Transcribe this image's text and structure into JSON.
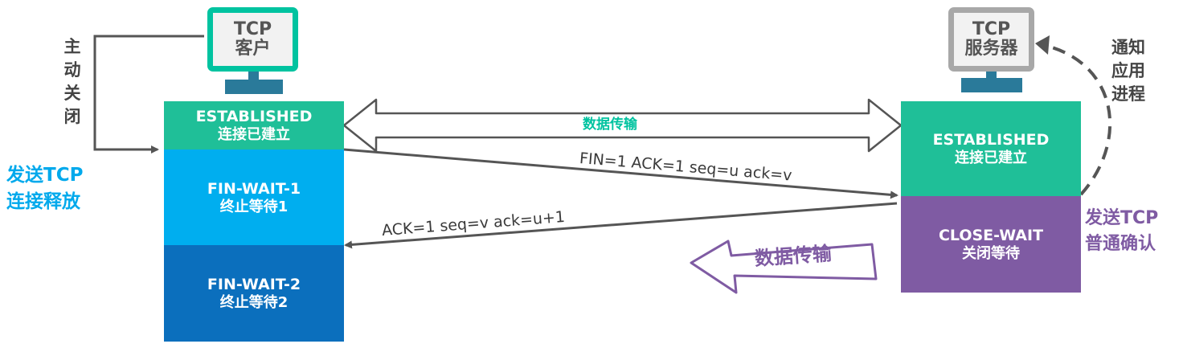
{
  "client": {
    "title": "TCP",
    "subtitle": "客户"
  },
  "server": {
    "title": "TCP",
    "subtitle": "服务器"
  },
  "client_states": [
    {
      "en": "ESTABLISHED",
      "cn": "连接已建立",
      "color": "#1fbf98"
    },
    {
      "en": "FIN-WAIT-1",
      "cn": "终止等待1",
      "color": "#00aeef"
    },
    {
      "en": "FIN-WAIT-2",
      "cn": "终止等待2",
      "color": "#0b6fbd"
    }
  ],
  "server_states": [
    {
      "en": "ESTABLISHED",
      "cn": "连接已建立",
      "color": "#1fbf98"
    },
    {
      "en": "CLOSE-WAIT",
      "cn": "关闭等待",
      "color": "#7f5ba3"
    }
  ],
  "labels": {
    "active_close": [
      "主",
      "动",
      "关",
      "闭"
    ],
    "send_release_line1": "发送TCP",
    "send_release_line2": "连接释放",
    "notify_app": [
      "通知",
      "应用",
      "进程"
    ],
    "send_ack_line1": "发送TCP",
    "send_ack_line2": "普通确认",
    "data_transfer_bidirectional": "数据传输",
    "data_transfer_server": "数据传输"
  },
  "messages": {
    "fin": "FIN=1   ACK=1   seq=u   ack=v",
    "ack": "ACK=1    seq=v    ack=u+1"
  },
  "colors": {
    "teal": "#00c3a0",
    "blue_label": "#00a9ec",
    "purple": "#7f5ba3",
    "arrow": "#555555"
  }
}
